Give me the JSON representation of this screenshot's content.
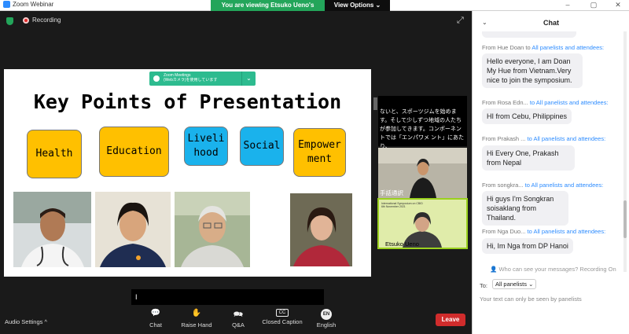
{
  "window": {
    "title": "Zoom Webinar"
  },
  "banner": {
    "viewing_text": "You are viewing Etsuko Ueno's screen",
    "view_options": "View Options ⌄"
  },
  "recording": {
    "label": "Recording"
  },
  "slide": {
    "zoom_notice_line1": "Zoom Meetings",
    "zoom_notice_line2": "(Webカメラ)を使用しています",
    "title": "Key Points of Presentation",
    "boxes": [
      {
        "label": "Health",
        "color": "#ffc000"
      },
      {
        "label": "Education",
        "color": "#ffc000"
      },
      {
        "label": "Liveli\nhood",
        "color": "#1ab2ec"
      },
      {
        "label": "Social",
        "color": "#1ab2ec"
      },
      {
        "label": "Empower\nment",
        "color": "#ffc000"
      }
    ]
  },
  "side": {
    "subtitle_text": "ないと、スポーツジムを始めます。そして少しずつ地域の人たちが参加してきます。コンポーネントでは「エンパワメ ント」にあたり、",
    "sign_label": "手話通訳",
    "speaker_label": "Etsuko Ueno",
    "slide_header": "International Symposium on CBID",
    "slide_sub": "6th November 2021"
  },
  "chat": {
    "title": "Chat",
    "messages": [
      {
        "from": "From Hue Doan to",
        "to": "All panelists and attendees:",
        "text": "Hello everyone, I am Doan My Hue from Vietnam.Very nice to join the symposium."
      },
      {
        "from": "From Rosa Edn...",
        "to": "to All panelists and attendees:",
        "text": "HI from Cebu, Philippines"
      },
      {
        "from": "From Prakash ...",
        "to": "to All panelists and attendees:",
        "text": "Hi Every One, Prakash from Nepal"
      },
      {
        "from": "From songkra...",
        "to": "to All panelists and attendees:",
        "text": "Hi guys I'm Songkran soisaklang from Thailand."
      },
      {
        "from": "From Nga Duo...",
        "to": "to All panelists and attendees:",
        "text": "Hi, Im Nga from DP Hanoi"
      }
    ],
    "privacy_note": "Who can see your messages? Recording On",
    "to_label": "To:",
    "recipient": "All panelists",
    "input_placeholder": "Your text can only be seen by panelists"
  },
  "toolbar": {
    "audio_settings": "Audio Settings",
    "buttons": [
      {
        "label": "Chat",
        "icon": "chat-icon"
      },
      {
        "label": "Raise Hand",
        "icon": "raise-hand-icon"
      },
      {
        "label": "Q&A",
        "icon": "qa-icon"
      },
      {
        "label": "Closed Caption",
        "icon": "cc-icon"
      },
      {
        "label": "English",
        "icon": "language-icon"
      }
    ],
    "leave": "Leave"
  },
  "caption": {
    "cursor": "I"
  }
}
